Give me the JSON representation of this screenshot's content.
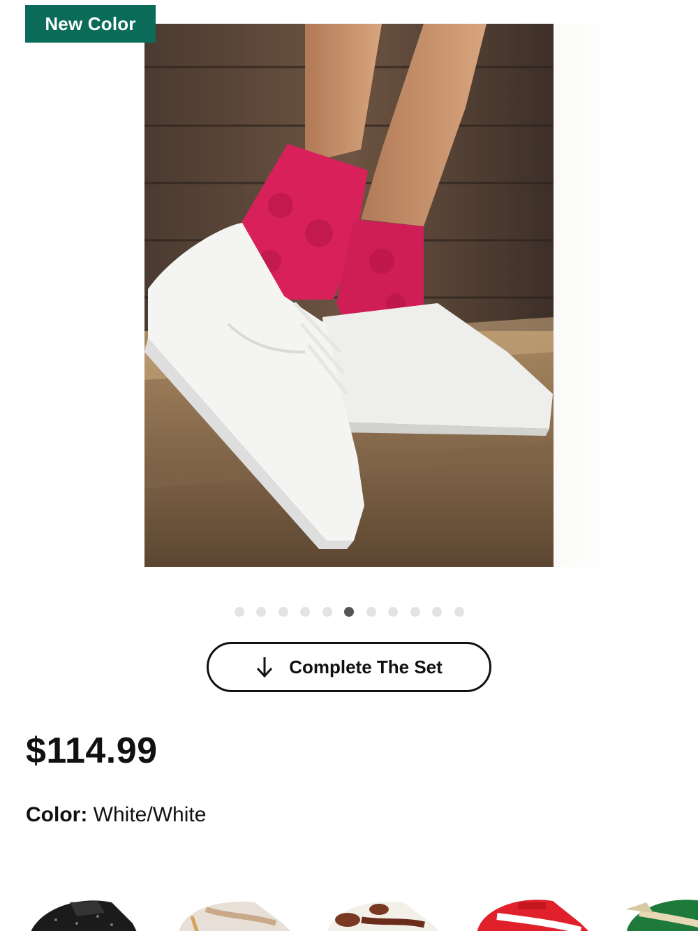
{
  "badge": {
    "label": "New Color",
    "color": "#0a6b58"
  },
  "gallery": {
    "image_alt": "Person wearing white low-top sneakers with pink socks",
    "dot_count": 11,
    "active_index": 5
  },
  "complete_set": {
    "label": "Complete The Set",
    "icon": "arrow-down-icon"
  },
  "product": {
    "price": "$114.99",
    "color_label": "Color:",
    "color_value": "White/White"
  },
  "color_swatches": [
    {
      "name": "black"
    },
    {
      "name": "cream"
    },
    {
      "name": "cow-print"
    },
    {
      "name": "red"
    },
    {
      "name": "green"
    }
  ]
}
